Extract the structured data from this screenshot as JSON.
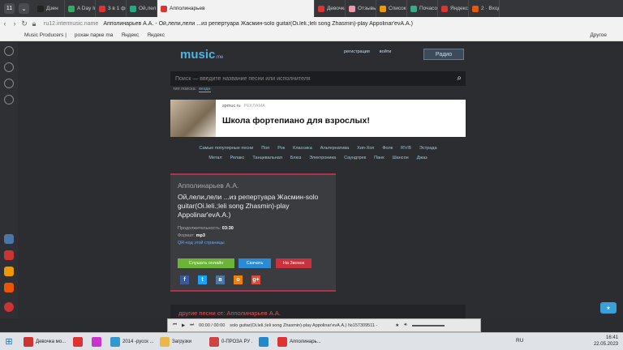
{
  "browser": {
    "tab_count": "11",
    "tabs": [
      {
        "label": "Дзен",
        "color": "#222"
      },
      {
        "label": "A Day In",
        "color": "#3a6"
      },
      {
        "label": "3 в 1 фор",
        "color": "#d33"
      },
      {
        "label": "Ой,лели",
        "color": "#2a8"
      },
      {
        "label": "Апполинарьев",
        "color": "#d33"
      },
      {
        "label": "Девочка",
        "color": "#d33"
      },
      {
        "label": "Отзывы",
        "color": "#e9a"
      },
      {
        "label": "Список п",
        "color": "#e90"
      },
      {
        "label": "Почасово",
        "color": "#3a8"
      },
      {
        "label": "Яндекс",
        "color": "#d33"
      },
      {
        "label": "2 · Входя",
        "color": "#e50"
      }
    ],
    "url": "ru12.intermusic.name",
    "page_title": "Апполинарьев А.А. - Ой,лели,лели ...из репертуара Жасмин-solo guitar(Oi.leli.;leli song Zhasmin)-play Appolinar'evA.A.)",
    "bookmarks": [
      "Music Producers |",
      "рохан парке ma",
      "Яндекс",
      "Яндекс"
    ],
    "bookmarks_other": "Другое"
  },
  "site": {
    "logo": "music",
    "logo_suffix": ".me",
    "register": "регистрация",
    "login": "войти",
    "radio": "Радио",
    "search_placeholder": "Поиск — введите название песни или исполнителя",
    "search_type_label": "тип поиска:",
    "search_type_value": "везде",
    "ad": {
      "source": "spmuc.ru",
      "tag": "РЕКЛАМА",
      "title": "Школа фортепиано для взрослых!"
    },
    "genres_row1": [
      "Самые популярные песни",
      "Поп",
      "Рок",
      "Классика",
      "Альтернатива",
      "Хип-Хоп",
      "Фолк",
      "R'n'B",
      "Эстрада"
    ],
    "genres_row2": [
      "Метал",
      "Релакс",
      "Танцевальная",
      "Блюз",
      "Электроника",
      "Саундтрек",
      "Панк",
      "Шансон",
      "Джаз"
    ],
    "card": {
      "artist": "Апполинарьев А.А.",
      "song": "Ой,лели,лели ...из репертуара Жасмин-solo guitar(Oi.leli.;leli song Zhasmin)-play Appolinar'evA.A.)",
      "duration_label": "Продолжительность:",
      "duration": "03:30",
      "format_label": "Формат:",
      "format": "mp3",
      "qr": "QR-код этой страницы",
      "listen": "Слушать онлайн",
      "download": "Скачать",
      "ringtone": "На Звонок"
    },
    "other_songs": "другие песни от: Апполинарьев А.А."
  },
  "player": {
    "time": "00:00 / 00:00",
    "track": "solo guitar(Oi.leli.;leli song Zhasmin)-play Appolinar'evA.A.) №157309511 -"
  },
  "taskbar": {
    "tasks": [
      {
        "label": "Девочка мо...",
        "color": "#c33"
      },
      {
        "label": "",
        "color": "#d33"
      },
      {
        "label": "",
        "color": "#c3c"
      },
      {
        "label": "2014 -русск ...",
        "color": "#39c"
      },
      {
        "label": "Загрузки",
        "color": "#e9b84a"
      },
      {
        "label": "0-ПРОЗА РУ ...",
        "color": "#c44"
      },
      {
        "label": "",
        "color": "#28c"
      },
      {
        "label": "Апполинарь...",
        "color": "#d33"
      }
    ],
    "lang": "RU",
    "time": "16:41",
    "date": "22.05.2023"
  }
}
